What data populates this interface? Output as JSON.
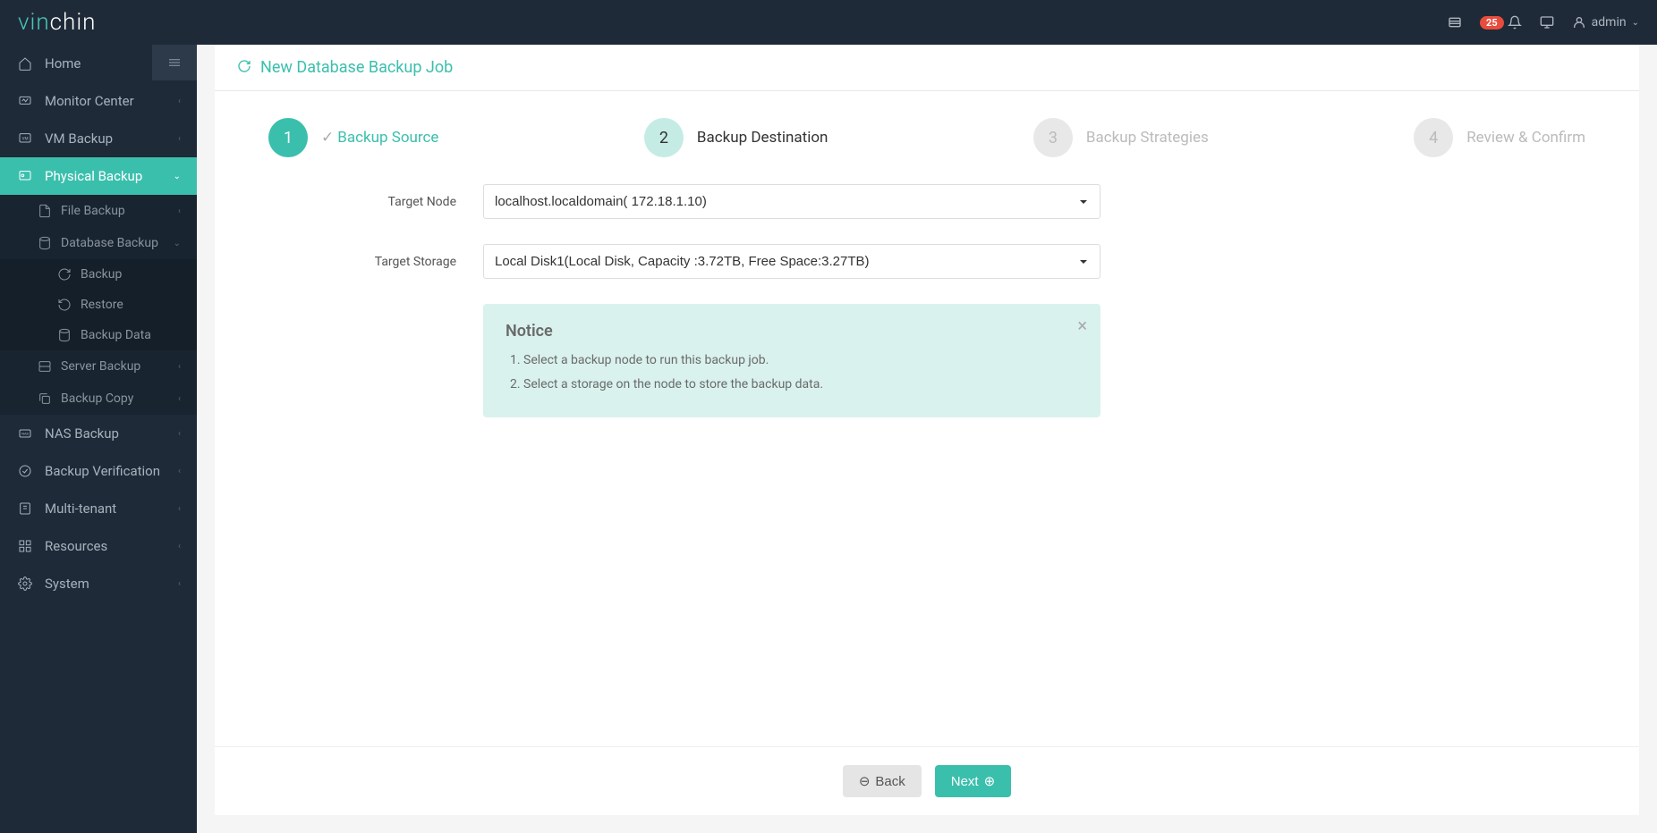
{
  "logo": {
    "part1": "vin",
    "part2": "chin"
  },
  "header": {
    "badge_count": "25",
    "username": "admin"
  },
  "sidebar": {
    "items": [
      {
        "label": "Home"
      },
      {
        "label": "Monitor Center"
      },
      {
        "label": "VM Backup"
      },
      {
        "label": "Physical Backup"
      },
      {
        "label": "NAS Backup"
      },
      {
        "label": "Backup Verification"
      },
      {
        "label": "Multi-tenant"
      },
      {
        "label": "Resources"
      },
      {
        "label": "System"
      }
    ],
    "physical_sub": [
      {
        "label": "File Backup"
      },
      {
        "label": "Database Backup"
      },
      {
        "label": "Server Backup"
      },
      {
        "label": "Backup Copy"
      }
    ],
    "database_sub": [
      {
        "label": "Backup"
      },
      {
        "label": "Restore"
      },
      {
        "label": "Backup Data"
      }
    ]
  },
  "page": {
    "title": "New Database Backup Job"
  },
  "wizard": {
    "steps": [
      {
        "num": "1",
        "label": "Backup Source"
      },
      {
        "num": "2",
        "label": "Backup Destination"
      },
      {
        "num": "3",
        "label": "Backup Strategies"
      },
      {
        "num": "4",
        "label": "Review & Confirm"
      }
    ]
  },
  "form": {
    "target_node_label": "Target Node",
    "target_node_value": "localhost.localdomain( 172.18.1.10)",
    "target_storage_label": "Target Storage",
    "target_storage_value": "Local Disk1(Local Disk, Capacity :3.72TB, Free Space:3.27TB)"
  },
  "notice": {
    "title": "Notice",
    "items": [
      "Select a backup node to run this backup job.",
      "Select a storage on the node to store the backup data."
    ]
  },
  "buttons": {
    "back": "Back",
    "next": "Next"
  }
}
